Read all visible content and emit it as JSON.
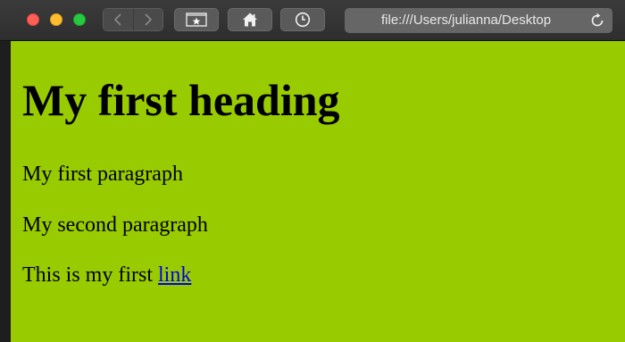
{
  "window": {
    "traffic_lights": {
      "close_color": "#fe5f57",
      "minimize_color": "#febc2e",
      "zoom_color": "#28c840"
    }
  },
  "toolbar": {
    "back_icon": "chevron-left-icon",
    "forward_icon": "chevron-right-icon",
    "favorites_icon": "star-icon",
    "home_icon": "home-icon",
    "history_icon": "clock-icon",
    "reload_icon": "reload-icon"
  },
  "address_bar": {
    "url": "file:///Users/julianna/Desktop"
  },
  "page": {
    "background_color": "#99cc00",
    "heading": "My first heading",
    "paragraph1": "My first paragraph",
    "paragraph2": "My second paragraph",
    "paragraph3_text": "This is my first",
    "link_text": "link",
    "link_color": "#0000ee"
  }
}
